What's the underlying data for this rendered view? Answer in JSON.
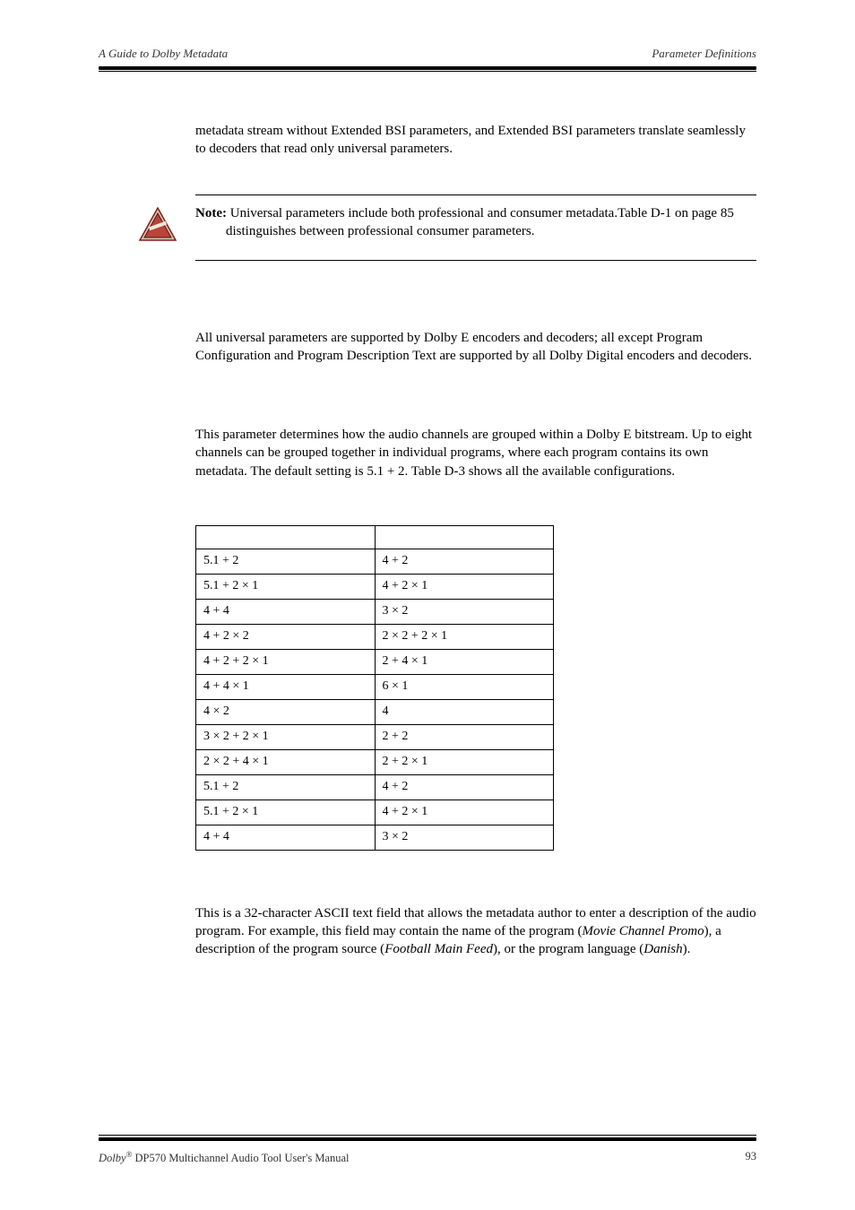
{
  "header": {
    "left": "A Guide to Dolby Metadata",
    "right": "Parameter Definitions"
  },
  "intro_para": "metadata stream without Extended BSI parameters, and Extended BSI parameters translate seamlessly to decoders that read only universal parameters.",
  "note": {
    "label": "Note:",
    "text": " Universal parameters include both professional and consumer metadata.Table D-1 on page 85 distinguishes between professional consumer parameters."
  },
  "universal_para": "All universal parameters are supported by Dolby E encoders and decoders; all except Program Configuration and Program Description Text are supported by all Dolby Digital encoders and decoders.",
  "config_para": "This parameter determines how the audio channels are grouped within a Dolby E bitstream. Up to eight channels can be grouped together in individual programs, where each program contains its own metadata. The default setting is 5.1 + 2. Table D-3 shows all the available configurations.",
  "table_rows": [
    [
      "5.1 + 2",
      "4 + 2"
    ],
    [
      "5.1 + 2 × 1",
      "4 + 2 × 1"
    ],
    [
      "4 + 4",
      "3 × 2"
    ],
    [
      "4 + 2 × 2",
      "2 × 2 + 2 × 1"
    ],
    [
      "4 + 2 + 2 × 1",
      "2 + 4 × 1"
    ],
    [
      "4 + 4 × 1",
      "6 × 1"
    ],
    [
      "4 × 2",
      "4"
    ],
    [
      "3 × 2 + 2 × 1",
      "2 + 2"
    ],
    [
      "2 × 2 + 4 × 1",
      "2 + 2 × 1"
    ],
    [
      "5.1 + 2",
      "4 + 2"
    ],
    [
      "5.1 + 2 × 1",
      "4 + 2 × 1"
    ],
    [
      "4 + 4",
      "3 × 2"
    ]
  ],
  "desc_para": {
    "pre": "This is a 32-character ASCII text field that allows the metadata author to enter a description of the audio program. For example, this field may contain the name of the program (",
    "em1": "Movie Channel Promo",
    "mid1": "), a description of the program source (",
    "em2": "Football Main Feed",
    "mid2": "), or the program language (",
    "em3": "Danish",
    "post": ")."
  },
  "footer": {
    "left_pre": "Dolby",
    "left_post": " DP570 Multichannel Audio Tool User's Manual",
    "page": "93"
  }
}
